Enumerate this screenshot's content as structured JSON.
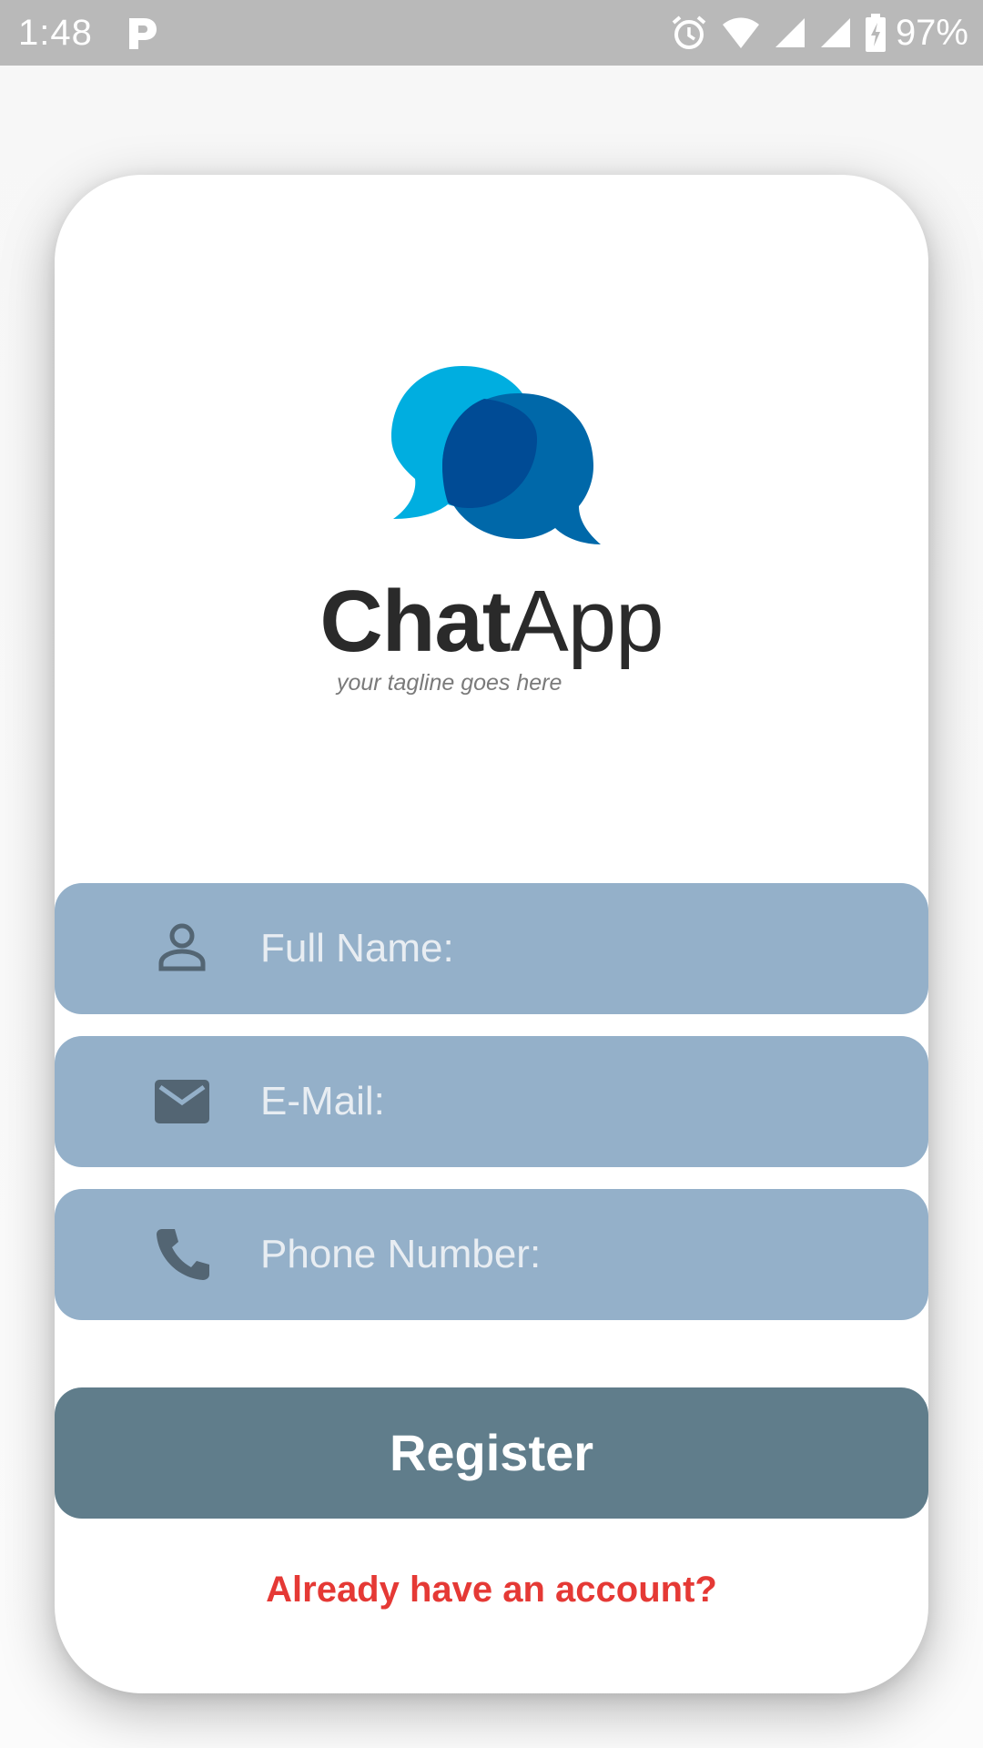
{
  "status_bar": {
    "time": "1:48",
    "battery": "97%",
    "notification_icon": "parking-p-icon",
    "icons": [
      "alarm-icon",
      "wifi-icon",
      "cell-signal-icon",
      "cell-signal-icon",
      "battery-charging-icon"
    ]
  },
  "logo": {
    "word_bold": "Chat",
    "word_regular": "App",
    "tagline": "your tagline goes here",
    "icon": "chat-bubbles-icon"
  },
  "form": {
    "full_name": {
      "label": "Full Name:",
      "icon": "person-icon"
    },
    "email": {
      "label": "E-Mail:",
      "icon": "mail-icon"
    },
    "phone": {
      "label": "Phone Number:",
      "icon": "phone-icon"
    }
  },
  "actions": {
    "register_label": "Register",
    "login_link": "Already have an account?"
  },
  "colors": {
    "status_bar": "#b9b9b9",
    "field_background": "#94b0c9",
    "field_text": "#e8edf2",
    "icon": "#536573",
    "button": "#607d8b",
    "link": "#e53935",
    "bubble_light": "#00aee0",
    "bubble_dark": "#0066a8"
  }
}
